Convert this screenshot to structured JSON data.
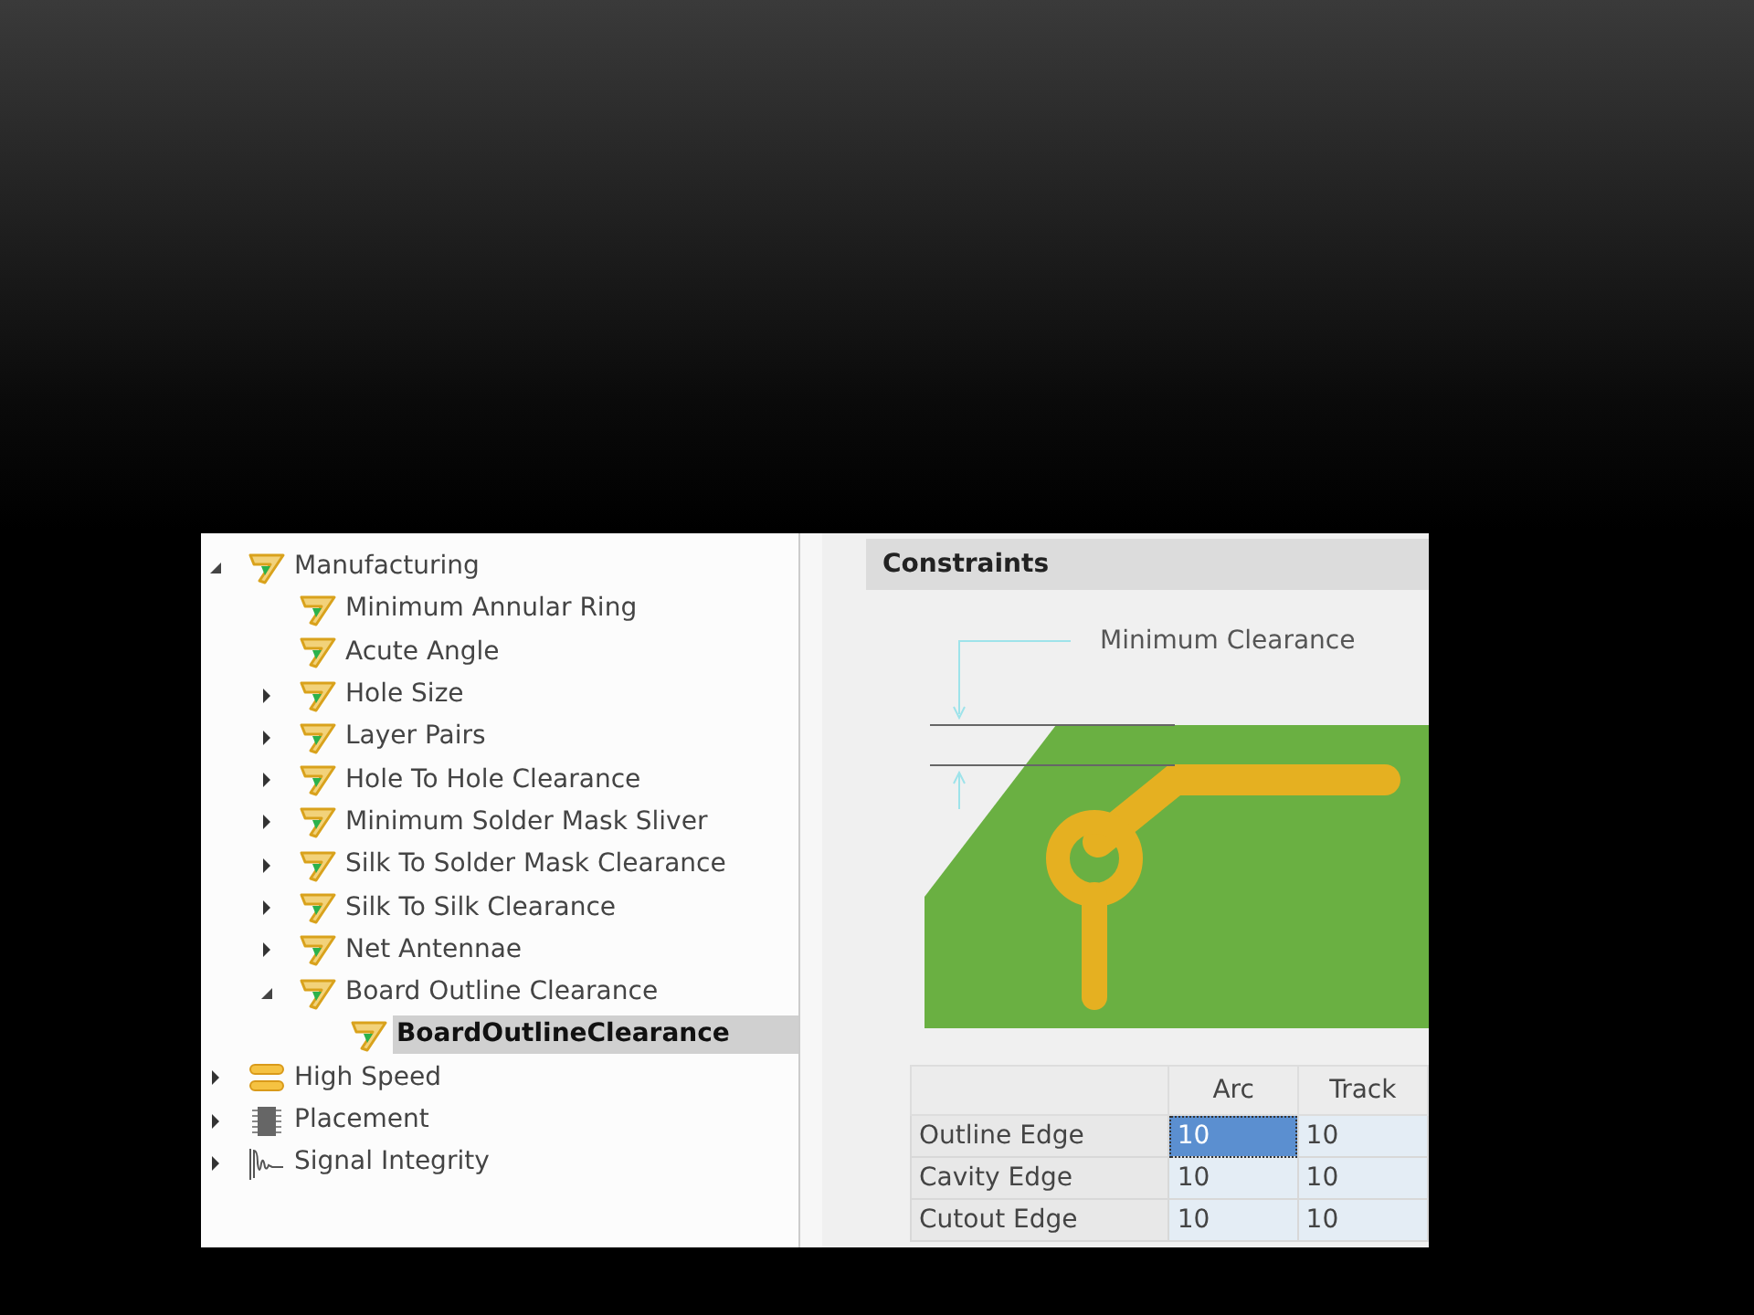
{
  "tree": [
    {
      "label": "Manufacturing",
      "kind": "rule",
      "expanded": true,
      "selected": false,
      "children": [
        {
          "label": "Minimum Annular Ring",
          "kind": "rule",
          "selected": false
        },
        {
          "label": "Acute Angle",
          "kind": "rule",
          "selected": false
        },
        {
          "label": "Hole Size",
          "kind": "rule",
          "expanded": false,
          "selected": false
        },
        {
          "label": "Layer Pairs",
          "kind": "rule",
          "expanded": false,
          "selected": false
        },
        {
          "label": "Hole To Hole Clearance",
          "kind": "rule",
          "expanded": false,
          "selected": false
        },
        {
          "label": "Minimum Solder Mask Sliver",
          "kind": "rule",
          "expanded": false,
          "selected": false
        },
        {
          "label": "Silk To Solder Mask Clearance",
          "kind": "rule",
          "expanded": false,
          "selected": false
        },
        {
          "label": "Silk To Silk Clearance",
          "kind": "rule",
          "expanded": false,
          "selected": false
        },
        {
          "label": "Net Antennae",
          "kind": "rule",
          "expanded": false,
          "selected": false
        },
        {
          "label": "Board Outline Clearance",
          "kind": "rule",
          "expanded": true,
          "selected": false,
          "children": [
            {
              "label": "BoardOutlineClearance",
              "kind": "rule",
              "selected": true
            }
          ]
        }
      ]
    },
    {
      "label": "High Speed",
      "kind": "high-speed",
      "expanded": false,
      "selected": false
    },
    {
      "label": "Placement",
      "kind": "placement",
      "expanded": false,
      "selected": false
    },
    {
      "label": "Signal Integrity",
      "kind": "signal",
      "expanded": false,
      "selected": false
    }
  ],
  "constraints": {
    "title": "Constraints",
    "diagram_label": "Minimum Clearance",
    "table": {
      "columns": [
        "Arc",
        "Track"
      ],
      "rows": [
        {
          "label": "Outline Edge",
          "cells": [
            {
              "value": "10",
              "selected": true
            },
            {
              "value": "10",
              "selected": false
            }
          ]
        },
        {
          "label": "Cavity Edge",
          "cells": [
            {
              "value": "10",
              "selected": false
            },
            {
              "value": "10",
              "selected": false
            }
          ]
        },
        {
          "label": "Cutout Edge",
          "cells": [
            {
              "value": "10",
              "selected": false
            },
            {
              "value": "10",
              "selected": false
            }
          ]
        }
      ]
    }
  }
}
